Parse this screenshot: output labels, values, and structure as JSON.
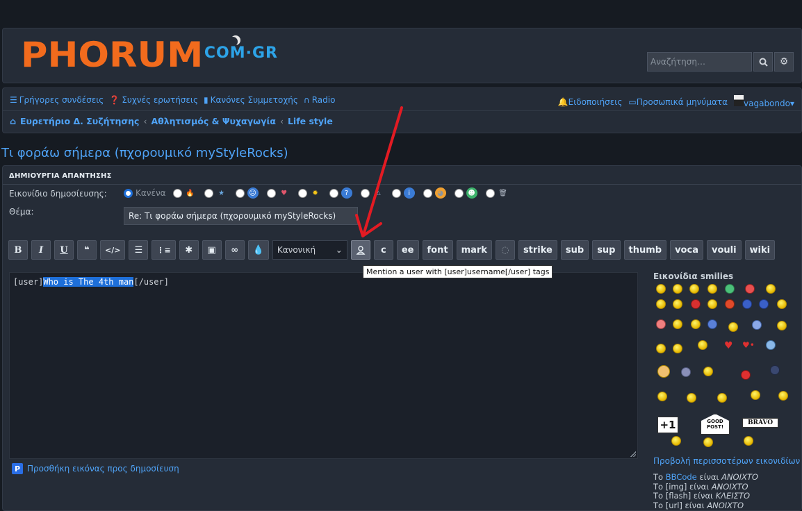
{
  "header": {
    "logo_main": "PHORUM",
    "logo_sub": "COM·GR",
    "search_placeholder": "Αναζήτηση…"
  },
  "nav": {
    "left": [
      "Γρήγορες συνδέσεις",
      "Συχνές ερωτήσεις",
      "Κανόνες Συμμετοχής",
      "Radio"
    ],
    "right": [
      "Ειδοποιήσεις",
      "Προσωπικά μηνύματα",
      "vagabondo"
    ]
  },
  "breadcrumbs": [
    "Ευρετήριο Δ. Συζήτησης",
    "Αθλητισμός & Ψυχαγωγία",
    "Life style"
  ],
  "page_title": "Τι φοράω σήμερα (πχορουμικό myStyleRocks)",
  "reply": {
    "heading": "ΔΗΜΙΟΥΡΓΙΑ ΑΠΑΝΤΗΣΗΣ",
    "post_icon_label": "Εικονίδιο δημοσίευσης:",
    "post_icon_none": "Κανένα",
    "subject_label": "Θέμα:",
    "subject_value": "Re: Τι φοράω σήμερα (πχορουμικό myStyleRocks)"
  },
  "toolbar": {
    "bold": "B",
    "italic": "I",
    "underline": "U",
    "font_size": "Κανονική",
    "custom_buttons": [
      "c",
      "ee",
      "font",
      "mark",
      "strike",
      "sub",
      "sup",
      "thumb",
      "voca",
      "vouli",
      "wiki"
    ],
    "tooltip": "Mention a user with [user]username[/user] tags"
  },
  "editor": {
    "open_tag": "[user]",
    "selected_text": "Who is The 4th man",
    "close_tag": "[/user]"
  },
  "attach_label": "Προσθήκη εικόνας προς δημοσίευση",
  "smilies": {
    "title": "Εικονίδια smilies",
    "more": "Προβολή περισσοτέρων εικονιδίων",
    "sign_plus1": "+1",
    "sign_good": "GOOD POST!",
    "sign_bravo": "BRAVO"
  },
  "rules": [
    {
      "prefix": "Το ",
      "name": "BBCode",
      "mid": " είναι ",
      "state": "ΑΝΟΙΧΤΟ"
    },
    {
      "prefix": "Το ",
      "name": "[img]",
      "mid": " είναι ",
      "state": "ΑΝΟΙΧΤΟ"
    },
    {
      "prefix": "Το ",
      "name": "[flash]",
      "mid": " είναι ",
      "state": "ΚΛΕΙΣΤΟ"
    },
    {
      "prefix": "Το ",
      "name": "[url]",
      "mid": " είναι ",
      "state": "ΑΝΟΙΧΤΟ"
    }
  ],
  "colors": {
    "accent": "#4fa3f7",
    "logo_orange": "#f26b1d",
    "logo_blue": "#2da4e8",
    "arrow_red": "#e31b23"
  }
}
